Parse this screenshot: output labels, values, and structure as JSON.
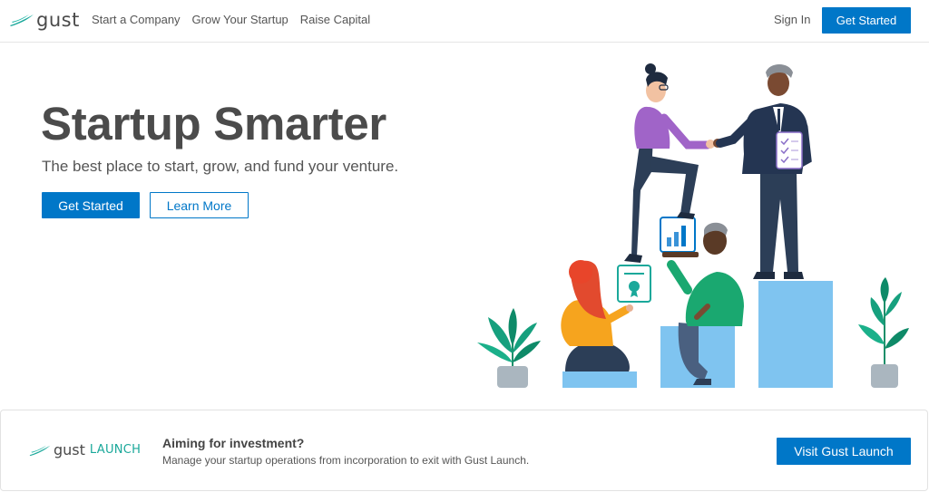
{
  "nav": {
    "logo_text": "gust",
    "links": [
      "Start a Company",
      "Grow Your Startup",
      "Raise Capital"
    ],
    "signin_label": "Sign In",
    "cta_label": "Get Started"
  },
  "hero": {
    "title": "Startup Smarter",
    "subtitle": "The best place to start, grow, and fund your venture.",
    "primary_cta": "Get Started",
    "secondary_cta": "Learn More"
  },
  "banner": {
    "logo_gust": "gust",
    "logo_launch": "LAUNCH",
    "title": "Aiming for investment?",
    "description": "Manage your startup operations from incorporation to exit with Gust Launch.",
    "cta_label": "Visit Gust Launch"
  },
  "colors": {
    "brand_blue": "#0077c8",
    "brand_teal": "#1aa89a",
    "pillar_blue": "#7fc4f0"
  },
  "icons": [
    "gust-logo-icon",
    "bar-chart-icon",
    "checklist-icon",
    "award-icon",
    "plant-icon"
  ]
}
